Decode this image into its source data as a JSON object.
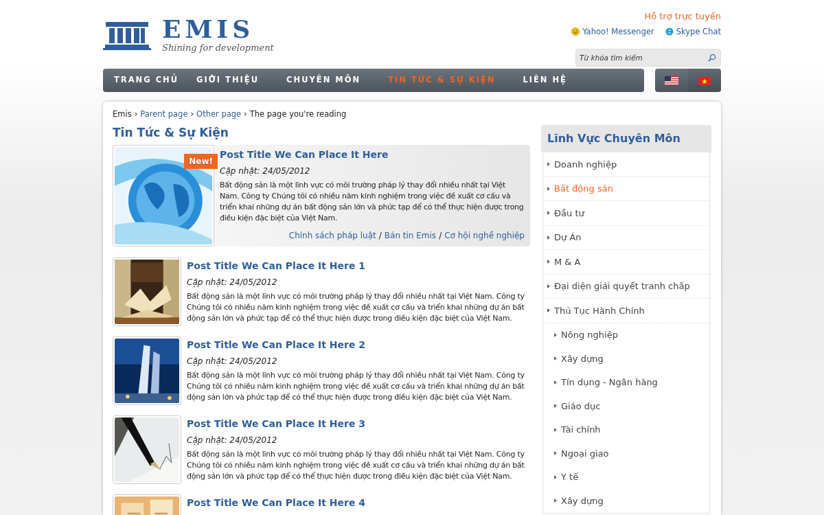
{
  "header": {
    "logo_text": "EMIS",
    "tagline": "Shining for development",
    "support": {
      "title": "Hỗ trợ trực tuyến",
      "links": [
        {
          "label": "Yahoo! Messenger",
          "kind": "yahoo"
        },
        {
          "label": "Skype Chat",
          "kind": "skype"
        }
      ]
    },
    "search": {
      "placeholder": "Từ khóa tìm kiếm"
    }
  },
  "nav": {
    "items": [
      {
        "label": "TRANG CHỦ",
        "selected": false
      },
      {
        "label": "GIỚI THIỆU",
        "selected": false
      },
      {
        "label": "CHUYÊN MÔN",
        "selected": false
      },
      {
        "label": "TIN TỨC & SỰ KIỆN",
        "selected": true
      },
      {
        "label": "LIÊN HỆ",
        "selected": false
      }
    ],
    "languages": [
      {
        "kind": "us"
      },
      {
        "kind": "vn"
      }
    ]
  },
  "breadcrumb": [
    {
      "kind": "text",
      "label": "Emis"
    },
    {
      "kind": "separator",
      "label": "›"
    },
    {
      "kind": "link",
      "label": "Parent page"
    },
    {
      "kind": "separator",
      "label": "›"
    },
    {
      "kind": "link",
      "label": "Other page"
    },
    {
      "kind": "separator",
      "label": "›"
    },
    {
      "kind": "text",
      "label": "The page you're reading"
    }
  ],
  "page_title": "Tin Tức & Sự Kiện",
  "featured": {
    "badge": "New!",
    "title": "Post Title We Can Place It Here",
    "date": "Cập nhật: 24/05/2012",
    "text": "Bất động sản là một lĩnh vực có môi trường pháp lý thay đổi nhiều nhất tại Việt Nam. Công ty Chúng tôi có nhiều năm kinh nghiệm trong việc đề xuất cơ cấu và triển khai những dự án bất động sản lớn và phức tạp để có thể thực hiện được trong điều kiện đặc biệt của Việt Nam.",
    "tags": [
      {
        "kind": "link",
        "label": "Chính sách pháp luật"
      },
      {
        "kind": "separator",
        "label": "/"
      },
      {
        "kind": "link",
        "label": "Bản tin Emis"
      },
      {
        "kind": "separator",
        "label": "/"
      },
      {
        "kind": "link",
        "label": "Cơ hội nghề nghiệp"
      }
    ]
  },
  "posts": [
    {
      "title": "Post Title We Can Place It Here 1",
      "date": "Cập nhật: 24/05/2012",
      "text": "Bất động sản là một lĩnh vực có môi trường pháp lý thay đổi nhiều nhất tại Việt Nam. Công ty Chúng tôi có nhiều năm kinh nghiệm trong việc đề xuất cơ cấu và triển khai những dự án bất động sản lớn và phức tạp để có thể thực hiện được trong điều kiện đặc biệt của Việt Nam."
    },
    {
      "title": "Post Title We Can Place It Here 2",
      "date": "Cập nhật: 24/05/2012",
      "text": "Bất động sản là một lĩnh vực có môi trường pháp lý thay đổi nhiều nhất tại Việt Nam. Công ty Chúng tôi có nhiều năm kinh nghiệm trong việc đề xuất cơ cấu và triển khai những dự án bất động sản lớn và phức tạp để có thể thực hiện được trong điều kiện đặc biệt của Việt Nam."
    },
    {
      "title": "Post Title We Can Place It Here 3",
      "date": "Cập nhật: 24/05/2012",
      "text": "Bất động sản là một lĩnh vực có môi trường pháp lý thay đổi nhiều nhất tại Việt Nam. Công ty Chúng tôi có nhiều năm kinh nghiệm trong việc đề xuất cơ cấu và triển khai những dự án bất động sản lớn và phức tạp để có thể thực hiện được trong điều kiện đặc biệt của Việt Nam."
    },
    {
      "title": "Post Title We Can Place It Here 4"
    }
  ],
  "sidebar": {
    "title": "Lĩnh Vực Chuyên Môn",
    "items": [
      {
        "label": "Doanh nghiệp",
        "selected": false
      },
      {
        "label": "Bất động sản",
        "selected": true
      },
      {
        "label": "Đầu tư",
        "selected": false
      },
      {
        "label": "Dự Án",
        "selected": false
      },
      {
        "label": "M & A",
        "selected": false
      },
      {
        "label": "Đại diện giải quyết tranh chấp",
        "selected": false
      },
      {
        "label": "Thủ Tục Hành Chính",
        "selected": false,
        "children": [
          {
            "label": "Nông nghiệp",
            "selected": false
          },
          {
            "label": "Xây dựng",
            "selected": false
          },
          {
            "label": "Tín dụng - Ngân hàng",
            "selected": false
          },
          {
            "label": "Giáo dục",
            "selected": false
          },
          {
            "label": "Tài chính",
            "selected": false
          },
          {
            "label": "Ngoại giao",
            "selected": false
          },
          {
            "label": "Y tế",
            "selected": false
          },
          {
            "label": "Xây dựng",
            "selected": false
          }
        ]
      }
    ]
  }
}
